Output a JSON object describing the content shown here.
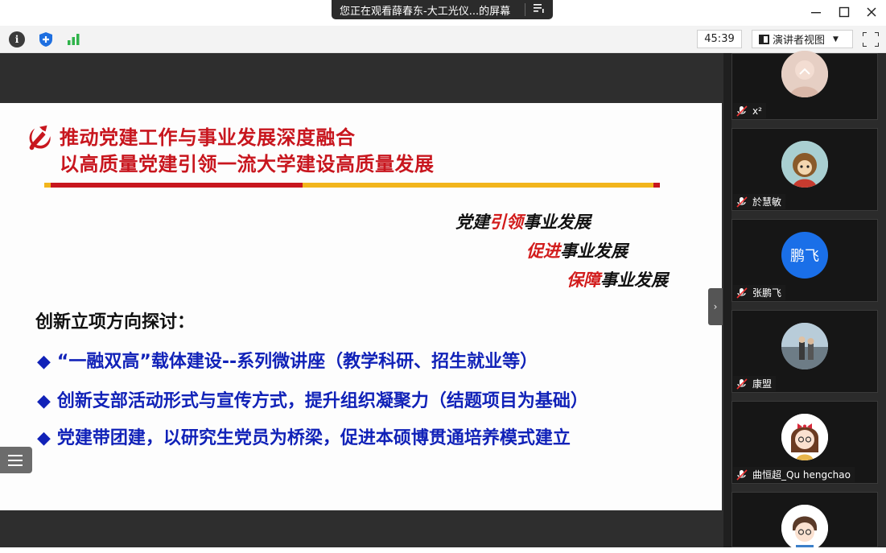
{
  "window": {
    "share_notice": "您正在观看薛春东-大工光仪...的屏幕",
    "share_menu_icon": "menu-lines-icon",
    "controls": [
      "minimize-icon",
      "maximize-icon",
      "close-icon"
    ]
  },
  "toolbar": {
    "icons": [
      "info-icon",
      "shield-icon",
      "signal-bars-icon"
    ],
    "timer": "45:39",
    "view_label": "演讲者视图",
    "fullscreen_icon": "fullscreen-icon"
  },
  "slide": {
    "title_line1": "推动党建工作与事业发展深度融合",
    "title_line2": "以高质量党建引领一流大学建设高质量发展",
    "slogans": [
      {
        "red": "引领",
        "prefix": "党建",
        "suffix": "事业发展"
      },
      {
        "red": "促进",
        "prefix": "",
        "suffix": "事业发展"
      },
      {
        "red": "保障",
        "prefix": "",
        "suffix": "事业发展"
      }
    ],
    "subtitle": "创新立项方向探讨：",
    "bullets": [
      "“一融双高”载体建设--系列微讲座（教学科研、招生就业等）",
      "创新支部活动形式与宣传方式，提升组织凝聚力（结题项目为基础）",
      "党建带团建，以研究生党员为桥梁，促进本硕博贯通培养模式建立"
    ],
    "bullet_marker": "◆",
    "colors": {
      "red": "#c8161e",
      "blue": "#1122b8",
      "bar_gold": "#f2b51c"
    }
  },
  "participants": [
    {
      "name": "x²",
      "avatar": "photo-avatar"
    },
    {
      "name": "於慧敏",
      "avatar": "cartoon-avatar"
    },
    {
      "name": "张鹏飞",
      "avatar_text": "鹏飞",
      "avatar_color": "#1a6fe8"
    },
    {
      "name": "康盟",
      "avatar": "photo-avatar"
    },
    {
      "name": "曲恒超_Qu hengchao",
      "avatar": "cartoon-girl-avatar"
    },
    {
      "name": "",
      "avatar": "cartoon-boy-avatar"
    }
  ]
}
